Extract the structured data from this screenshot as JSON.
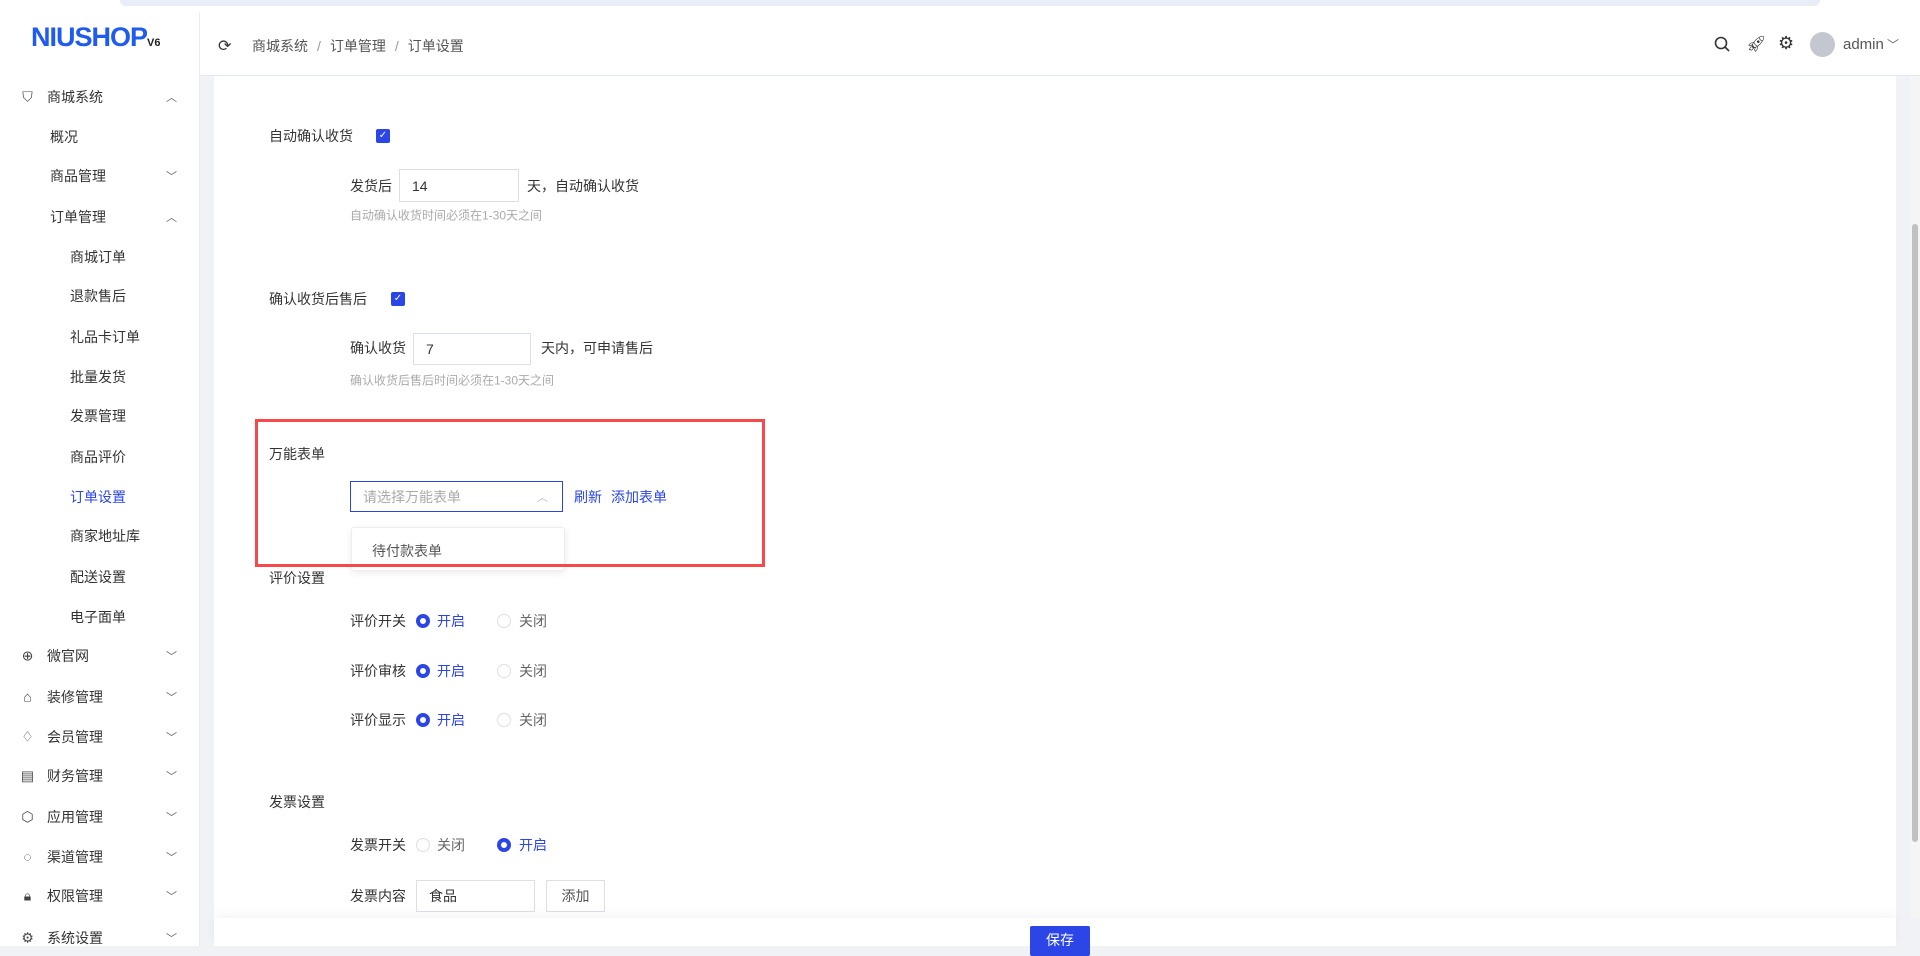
{
  "brand": {
    "logo": "NIUSHOP",
    "version": "V6"
  },
  "breadcrumb": [
    "商城系统",
    "订单管理",
    "订单设置"
  ],
  "header": {
    "user": "admin"
  },
  "sidebar": {
    "items": [
      {
        "label": "商城系统",
        "level": 1,
        "icon": "bag-icon",
        "chev": "^"
      },
      {
        "label": "概况",
        "level": 2
      },
      {
        "label": "商品管理",
        "level": 2,
        "chev": "v"
      },
      {
        "label": "订单管理",
        "level": 2,
        "chev": "^"
      },
      {
        "label": "商城订单",
        "level": 3
      },
      {
        "label": "退款售后",
        "level": 3
      },
      {
        "label": "礼品卡订单",
        "level": 3
      },
      {
        "label": "批量发货",
        "level": 3
      },
      {
        "label": "发票管理",
        "level": 3
      },
      {
        "label": "商品评价",
        "level": 3
      },
      {
        "label": "订单设置",
        "level": 3,
        "active": true
      },
      {
        "label": "商家地址库",
        "level": 3
      },
      {
        "label": "配送设置",
        "level": 3
      },
      {
        "label": "电子面单",
        "level": 3
      },
      {
        "label": "微官网",
        "level": 1,
        "icon": "globe-icon",
        "chev": "v"
      },
      {
        "label": "装修管理",
        "level": 1,
        "icon": "brush-icon",
        "chev": "v"
      },
      {
        "label": "会员管理",
        "level": 1,
        "icon": "diamond-icon",
        "chev": "v"
      },
      {
        "label": "财务管理",
        "level": 1,
        "icon": "finance-icon",
        "chev": "v"
      },
      {
        "label": "应用管理",
        "level": 1,
        "icon": "cube-icon",
        "chev": "v"
      },
      {
        "label": "渠道管理",
        "level": 1,
        "icon": "channel-icon",
        "chev": "v"
      },
      {
        "label": "权限管理",
        "level": 1,
        "icon": "lock-icon",
        "chev": "v"
      },
      {
        "label": "系统设置",
        "level": 1,
        "icon": "gear-icon",
        "chev": "v"
      }
    ]
  },
  "auto_confirm": {
    "label": "自动确认收货",
    "checked": true,
    "prefix": "发货后",
    "value": "14",
    "suffix": "天，自动确认收货",
    "hint": "自动确认收货时间必须在1-30天之间"
  },
  "after_sale": {
    "label": "确认收货后售后",
    "checked": true,
    "prefix": "确认收货",
    "value": "7",
    "suffix": "天内，可申请售后",
    "hint": "确认收货后售后时间必须在1-30天之间"
  },
  "form": {
    "label": "万能表单",
    "placeholder": "请选择万能表单",
    "refresh": "刷新",
    "add": "添加表单",
    "options": [
      "待付款表单"
    ]
  },
  "review": {
    "label": "评价设置",
    "rows": [
      {
        "label": "评价开关",
        "on": "开启",
        "off": "关闭",
        "value": "on"
      },
      {
        "label": "评价审核",
        "on": "开启",
        "off": "关闭",
        "value": "on"
      },
      {
        "label": "评价显示",
        "on": "开启",
        "off": "关闭",
        "value": "on"
      }
    ]
  },
  "invoice": {
    "label": "发票设置",
    "switch_label": "发票开关",
    "off": "关闭",
    "on": "开启",
    "value": "on",
    "content_label": "发票内容",
    "content_value": "食品",
    "add": "添加"
  },
  "footer": {
    "save": "保存"
  },
  "colors": {
    "accent": "#2b45e6",
    "highlight": "#f5494b"
  }
}
